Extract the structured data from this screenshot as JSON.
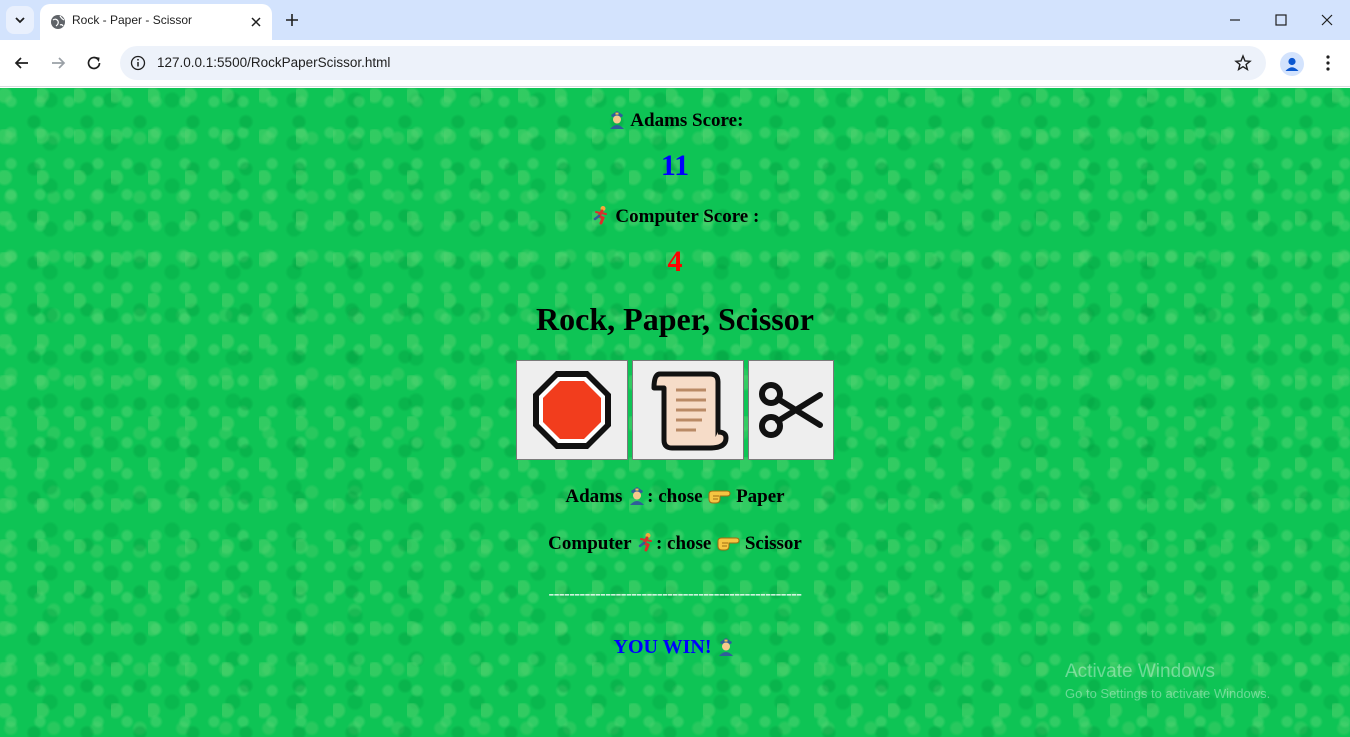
{
  "browser": {
    "tab_title": "Rock - Paper - Scissor",
    "url": "127.0.0.1:5500/RockPaperScissor.html"
  },
  "game": {
    "player_label": "Adams Score:",
    "player_score": "11",
    "computer_label": "Computer Score :",
    "computer_score": "4",
    "title": "Rock, Paper, Scissor",
    "choices": [
      "rock",
      "paper",
      "scissor"
    ],
    "player_choice_prefix": "Adams",
    "chose_text": ": chose",
    "player_choice_value": "Paper",
    "computer_choice_prefix": "Computer",
    "computer_choice_value": "Scissor",
    "divider": "-------------------------------------------------",
    "result": "YOU WIN!"
  },
  "colors": {
    "background": "#0ec455",
    "player_score": "#0000ff",
    "computer_score": "#ff0000",
    "result": "#0000ff"
  },
  "watermark": {
    "title": "Activate Windows",
    "subtitle": "Go to Settings to activate Windows."
  }
}
